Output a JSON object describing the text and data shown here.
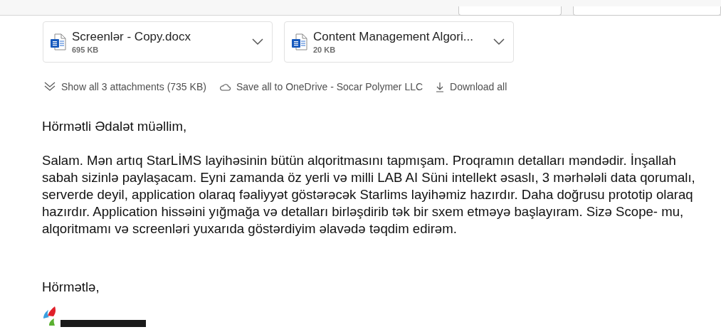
{
  "attachments": [
    {
      "name": "Screenlər - Copy.docx",
      "size": "695 KB"
    },
    {
      "name": "Content Management Algori...",
      "size": "20 KB"
    }
  ],
  "actions": [
    {
      "kind": "expand",
      "label": "Show all 3 attachments (735 KB)"
    },
    {
      "kind": "cloud",
      "label": "Save all to OneDrive - Socar Polymer LLC"
    },
    {
      "kind": "download",
      "label": "Download all"
    }
  ],
  "body": {
    "greeting": "Hörmətli Ədalət müəllim,",
    "paragraph": "Salam. Mən artıq StarLİMS layihəsinin bütün alqoritmasını tapmışam. Proqramın detalları məndədir. İnşallah sabah sizinlə paylaşacam. Eyni zamanda öz yerli və milli LAB AI Süni intellekt əsaslı, 3 mərhələli data qorumalı, serverde deyil, application olaraq fəaliyyət göstərəcək Starlims layihəmiz hazırdır. Daha doğrusu prototip olaraq hazırdır. Application hissəini yığmağa və detalları birləşdirib tək bir sxem etməyə başlayıram. Sizə Scope- mu, alqoritmamı və screenləri yuxarıda göstərdiyim əlavədə təqdim edirəm.",
    "closing": "Hörmətlə,"
  }
}
